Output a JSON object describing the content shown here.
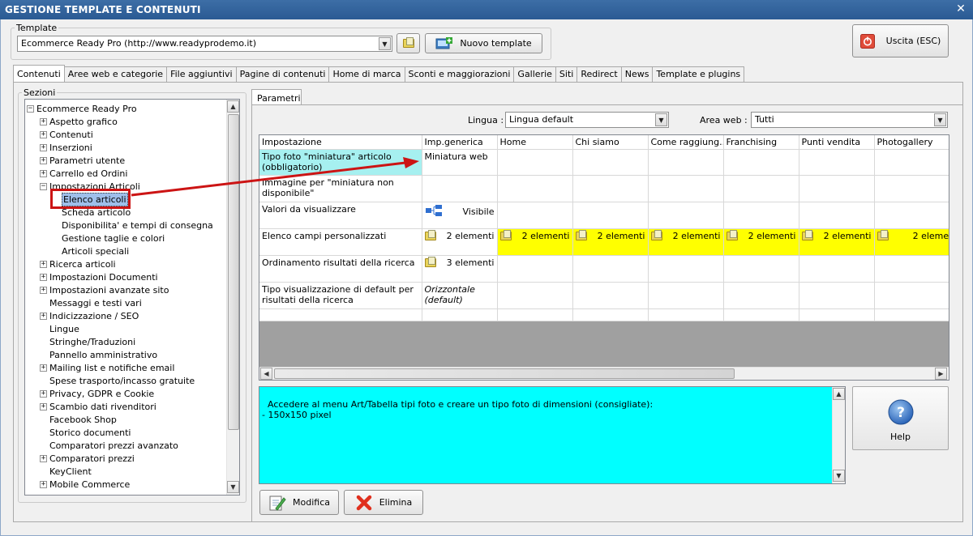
{
  "window": {
    "title": "GESTIONE TEMPLATE E CONTENUTI",
    "close_glyph": "✕"
  },
  "template_group": {
    "legend": "Template",
    "selected": "Ecommerce Ready Pro (http://www.readyprodemo.it)",
    "new_button": "Nuovo template"
  },
  "exit_button": "Uscita (ESC)",
  "tabs": [
    "Contenuti",
    "Aree web e categorie",
    "File aggiuntivi",
    "Pagine di contenuti",
    "Home di marca",
    "Sconti e maggiorazioni",
    "Gallerie",
    "Siti",
    "Redirect",
    "News",
    "Template e plugins"
  ],
  "sections": {
    "legend": "Sezioni",
    "items": [
      {
        "label": "Ecommerce Ready Pro",
        "level": 0,
        "exp": "minus"
      },
      {
        "label": "Aspetto grafico",
        "level": 1,
        "exp": "plus"
      },
      {
        "label": "Contenuti",
        "level": 1,
        "exp": "plus"
      },
      {
        "label": "Inserzioni",
        "level": 1,
        "exp": "plus"
      },
      {
        "label": "Parametri utente",
        "level": 1,
        "exp": "plus"
      },
      {
        "label": "Carrello ed Ordini",
        "level": 1,
        "exp": "plus"
      },
      {
        "label": "Impostazioni Articoli",
        "level": 1,
        "exp": "minus"
      },
      {
        "label": "Elenco articoli",
        "level": 2,
        "exp": "",
        "selected": true
      },
      {
        "label": "Scheda articolo",
        "level": 2,
        "exp": ""
      },
      {
        "label": "Disponibilita' e tempi di consegna",
        "level": 2,
        "exp": ""
      },
      {
        "label": "Gestione taglie e colori",
        "level": 2,
        "exp": ""
      },
      {
        "label": "Articoli speciali",
        "level": 2,
        "exp": ""
      },
      {
        "label": "Ricerca articoli",
        "level": 1,
        "exp": "plus"
      },
      {
        "label": "Impostazioni Documenti",
        "level": 1,
        "exp": "plus"
      },
      {
        "label": "Impostazioni avanzate sito",
        "level": 1,
        "exp": "plus"
      },
      {
        "label": "Messaggi e testi vari",
        "level": 1,
        "exp": ""
      },
      {
        "label": "Indicizzazione / SEO",
        "level": 1,
        "exp": "plus"
      },
      {
        "label": "Lingue",
        "level": 1,
        "exp": ""
      },
      {
        "label": "Stringhe/Traduzioni",
        "level": 1,
        "exp": ""
      },
      {
        "label": "Pannello amministrativo",
        "level": 1,
        "exp": ""
      },
      {
        "label": "Mailing list e notifiche email",
        "level": 1,
        "exp": "plus"
      },
      {
        "label": "Spese trasporto/incasso gratuite",
        "level": 1,
        "exp": ""
      },
      {
        "label": "Privacy, GDPR e Cookie",
        "level": 1,
        "exp": "plus"
      },
      {
        "label": "Scambio dati rivenditori",
        "level": 1,
        "exp": "plus"
      },
      {
        "label": "Facebook Shop",
        "level": 1,
        "exp": ""
      },
      {
        "label": "Storico documenti",
        "level": 1,
        "exp": ""
      },
      {
        "label": "Comparatori prezzi avanzato",
        "level": 1,
        "exp": ""
      },
      {
        "label": "Comparatori prezzi",
        "level": 1,
        "exp": "plus"
      },
      {
        "label": "KeyClient",
        "level": 1,
        "exp": ""
      },
      {
        "label": "Mobile Commerce",
        "level": 1,
        "exp": "plus"
      }
    ]
  },
  "params": {
    "tab": "Parametri",
    "lingua_label": "Lingua :",
    "lingua_value": "Lingua default",
    "area_label": "Area web :",
    "area_value": "Tutti",
    "columns": [
      "Impostazione",
      "Imp.generica",
      "Home",
      "Chi siamo",
      "Come raggiung...",
      "Franchising",
      "Punti vendita",
      "Photogallery"
    ],
    "rows": [
      {
        "name": "Tipo foto \"miniatura\" articolo (obbligatorio)",
        "generic": "Miniatura web",
        "kind": "text",
        "highlight": true
      },
      {
        "name": "Immagine per \"miniatura non disponibile\"",
        "generic": "",
        "kind": "text"
      },
      {
        "name": "Valori da visualizzare",
        "generic": "Visibile",
        "kind": "tree"
      },
      {
        "name": "Elenco campi personalizzati",
        "generic": "2 elementi",
        "kind": "folder",
        "yellow": true,
        "others": "2 elementi"
      },
      {
        "name": "Ordinamento risultati della ricerca",
        "generic": "3 elementi",
        "kind": "folder"
      },
      {
        "name": "Tipo visualizzazione di default per risultati della ricerca",
        "generic": "Orizzontale (default)",
        "kind": "italic"
      }
    ]
  },
  "description": "Accedere al menu Art/Tabella tipi foto e creare un tipo foto di dimensioni (consigliate):\n- 150x150 pixel",
  "help_button": "Help",
  "modifica_button": "Modifica",
  "elimina_button": "Elimina",
  "colors": {
    "title_bar": "#2f639e",
    "highlight_cell": "#a6f0f0",
    "yellow": "#ffff00",
    "description_bg": "#00ffff",
    "arrow": "#cc0000"
  }
}
